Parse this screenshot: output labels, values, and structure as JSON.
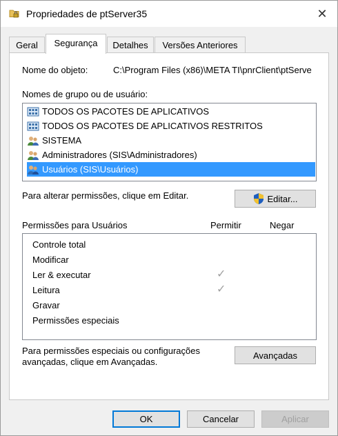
{
  "window": {
    "title": "Propriedades de ptServer35",
    "title_icon": "folder-lock-icon",
    "close_glyph": "✕"
  },
  "tabs": [
    {
      "label": "Geral",
      "active": false
    },
    {
      "label": "Segurança",
      "active": true
    },
    {
      "label": "Detalhes",
      "active": false
    },
    {
      "label": "Versões Anteriores",
      "active": false
    }
  ],
  "object": {
    "label": "Nome do objeto:",
    "value": "C:\\Program Files (x86)\\META TI\\pnrClient\\ptServe"
  },
  "groups": {
    "label": "Nomes de grupo ou de usuário:",
    "items": [
      {
        "label": "TODOS OS PACOTES DE APLICATIVOS",
        "icon": "app-packages-icon",
        "selected": false
      },
      {
        "label": "TODOS OS PACOTES DE APLICATIVOS RESTRITOS",
        "icon": "app-packages-icon",
        "selected": false
      },
      {
        "label": "SISTEMA",
        "icon": "users-group-icon",
        "selected": false
      },
      {
        "label": "Administradores (SIS\\Administradores)",
        "icon": "users-group-icon",
        "selected": false
      },
      {
        "label": "Usuários (SIS\\Usuários)",
        "icon": "users-group-icon",
        "selected": true
      }
    ]
  },
  "edit": {
    "hint": "Para alterar permissões, clique em Editar.",
    "button": "Editar..."
  },
  "permissions": {
    "header": "Permissões para Usuários",
    "allow_header": "Permitir",
    "deny_header": "Negar",
    "rows": [
      {
        "label": "Controle total",
        "allow": false,
        "deny": false
      },
      {
        "label": "Modificar",
        "allow": false,
        "deny": false
      },
      {
        "label": "Ler & executar",
        "allow": true,
        "deny": false
      },
      {
        "label": "Leitura",
        "allow": true,
        "deny": false
      },
      {
        "label": "Gravar",
        "allow": false,
        "deny": false
      },
      {
        "label": "Permissões especiais",
        "allow": false,
        "deny": false
      }
    ],
    "check_glyph": "✓"
  },
  "advanced": {
    "hint_line1": "Para permissões especiais ou configurações",
    "hint_line2": "avançadas, clique em Avançadas.",
    "button": "Avançadas"
  },
  "footer": {
    "ok": "OK",
    "cancel": "Cancelar",
    "apply": "Aplicar"
  }
}
